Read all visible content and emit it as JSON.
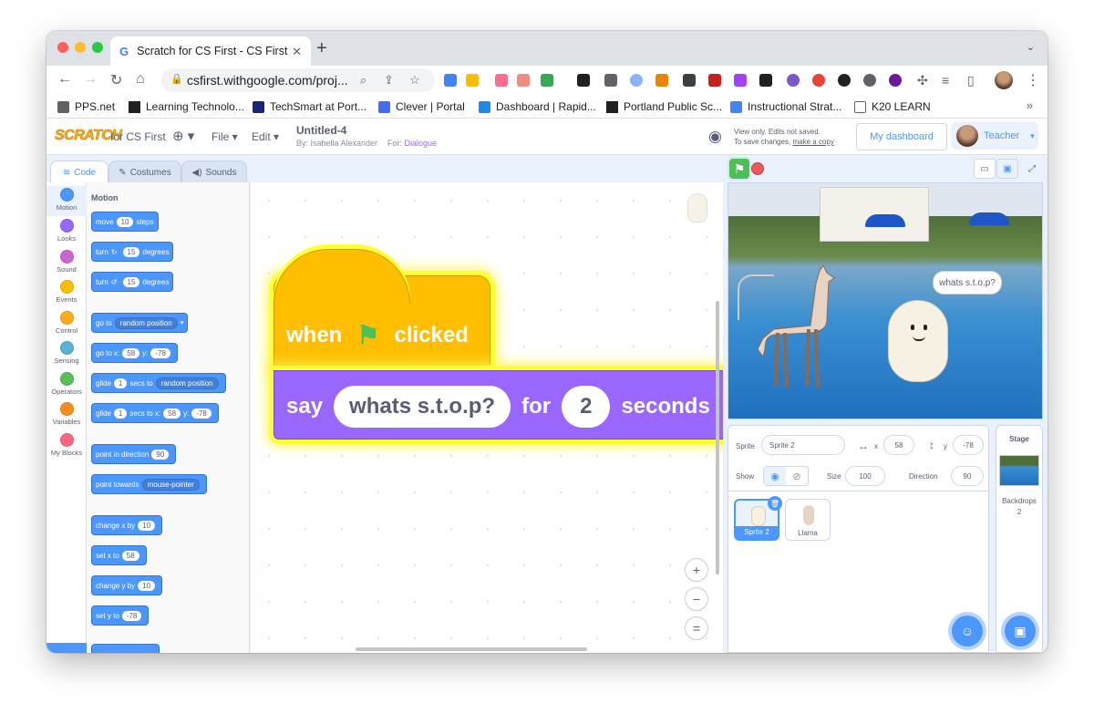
{
  "browser": {
    "tab_title": "Scratch for CS First - CS First",
    "url": "csfirst.withgoogle.com/proj...",
    "bookmarks": [
      "PPS.net",
      "Learning Technolo...",
      "TechSmart at Port...",
      "Clever | Portal",
      "Dashboard | Rapid...",
      "Portland Public Sc...",
      "Instructional Strat...",
      "K20 LEARN"
    ],
    "more_bookmarks": "»"
  },
  "menubar": {
    "logo": "SCRATCH",
    "brand_suffix": "for CS First",
    "file": "File",
    "edit": "Edit",
    "project_title": "Untitled-4",
    "by_line": "By: Isabella Alexander",
    "for_label": "For:",
    "for_value": "Dialogue",
    "view_only_line1": "View only. Edits not saved.",
    "view_only_line2": "To save changes,",
    "make_copy": "make a copy",
    "dashboard_btn": "My dashboard",
    "account_name": "Teacher"
  },
  "editor_tabs": [
    "Code",
    "Costumes",
    "Sounds"
  ],
  "categories": [
    {
      "label": "Motion",
      "color": "#4c97ff"
    },
    {
      "label": "Looks",
      "color": "#9966ff"
    },
    {
      "label": "Sound",
      "color": "#cf63cf"
    },
    {
      "label": "Events",
      "color": "#ffbf00"
    },
    {
      "label": "Control",
      "color": "#ffab19"
    },
    {
      "label": "Sensing",
      "color": "#5cb1d6"
    },
    {
      "label": "Operators",
      "color": "#59c059"
    },
    {
      "label": "Variables",
      "color": "#ff8c1a"
    },
    {
      "label": "My Blocks",
      "color": "#ff6680"
    }
  ],
  "palette": {
    "section": "Motion",
    "move": {
      "a": "move",
      "v": "10",
      "b": "steps"
    },
    "turn_right": {
      "a": "turn",
      "v": "15",
      "b": "degrees"
    },
    "turn_left": {
      "a": "turn",
      "v": "15",
      "b": "degrees"
    },
    "goto": {
      "a": "go to",
      "dd": "random position"
    },
    "goto_xy": {
      "a": "go to x:",
      "x": "58",
      "b": "y:",
      "y": "-78"
    },
    "glide_random": {
      "a": "glide",
      "v": "1",
      "b": "secs to",
      "dd": "random position"
    },
    "glide_xy": {
      "a": "glide",
      "v": "1",
      "b": "secs to x:",
      "x": "58",
      "c": "y:",
      "y": "-78"
    },
    "point_dir": {
      "a": "point in direction",
      "v": "90"
    },
    "point_towards": {
      "a": "point towards",
      "dd": "mouse-pointer"
    },
    "change_x": {
      "a": "change x by",
      "v": "10"
    },
    "set_x": {
      "a": "set x to",
      "v": "58"
    },
    "change_y": {
      "a": "change y by",
      "v": "10"
    },
    "set_y": {
      "a": "set y to",
      "v": "-78"
    }
  },
  "script": {
    "when": "when",
    "clicked": "clicked",
    "say": "say",
    "message": "whats s.t.o.p?",
    "for": "for",
    "seconds_value": "2",
    "seconds": "seconds"
  },
  "stage": {
    "speech": "whats s.t.o.p?"
  },
  "sprite_info": {
    "sprite_label": "Sprite",
    "sprite_name": "Sprite 2",
    "x_label": "x",
    "x": "58",
    "y_label": "y",
    "y": "-78",
    "show_label": "Show",
    "size_label": "Size",
    "size": "100",
    "direction_label": "Direction",
    "direction": "90"
  },
  "sprites": [
    {
      "name": "Sprite 2",
      "selected": true
    },
    {
      "name": "Llama",
      "selected": false
    }
  ],
  "stage_panel": {
    "title": "Stage",
    "backdrops_label": "Backdrops",
    "backdrops_count": "2"
  },
  "colors": {
    "motion": "#4c97ff",
    "events": "#ffbf00",
    "looks": "#9966ff",
    "glow": "#ffff33"
  }
}
